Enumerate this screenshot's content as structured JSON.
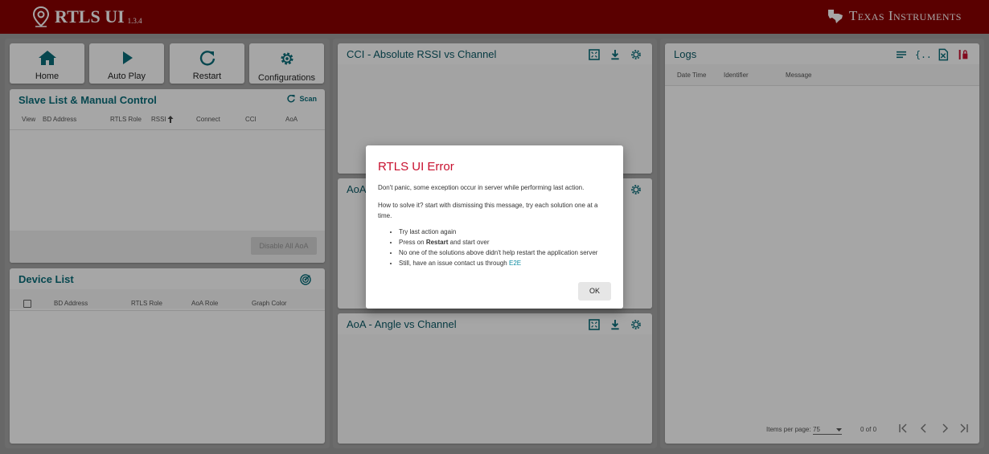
{
  "header": {
    "app_name": "RTLS UI",
    "version": "1.3.4",
    "brand": "Texas Instruments"
  },
  "nav": {
    "home": "Home",
    "auto_play": "Auto Play",
    "restart": "Restart",
    "configurations": "Configurations"
  },
  "slave_list": {
    "title": "Slave List & Manual Control",
    "scan": "Scan",
    "columns": [
      "View",
      "BD Address",
      "RTLS Role",
      "RSSI",
      "Connect",
      "CCI",
      "AoA"
    ],
    "disable_button": "Disable All AoA"
  },
  "device_list": {
    "title": "Device List",
    "columns": [
      "BD Address",
      "RTLS Role",
      "AoA Role",
      "Graph Color"
    ]
  },
  "cci_panel": {
    "title": "CCI - Absolute RSSI vs Channel"
  },
  "aoa_panel_partial": {
    "title": "AoA"
  },
  "aoa_angle_panel": {
    "title": "AoA - Angle vs Channel"
  },
  "logs": {
    "title": "Logs",
    "columns": [
      "Date Time",
      "Identifier",
      "Message"
    ],
    "items_per_page_label": "Items per page:",
    "items_per_page": "75",
    "range": "0 of 0"
  },
  "dialog": {
    "title": "RTLS UI Error",
    "p1": "Don't panic, some exception occur in server while performing last action.",
    "p2": "How to solve it? start with dismissing this message, try each solution one at a time.",
    "item1": "Try last action again",
    "item2_pre": "Press on",
    "item2_bold": "Restart",
    "item2_post": "and start over",
    "item3": "No one of the solutions above didn't help restart the application server",
    "item4_pre": "Still, have an issue contact us through",
    "item4_link": "E2E",
    "ok": "OK"
  },
  "colors": {
    "header": "#8b0000",
    "accent": "#0a6e7a",
    "error": "#c8102e",
    "link": "#0a8aa0"
  }
}
